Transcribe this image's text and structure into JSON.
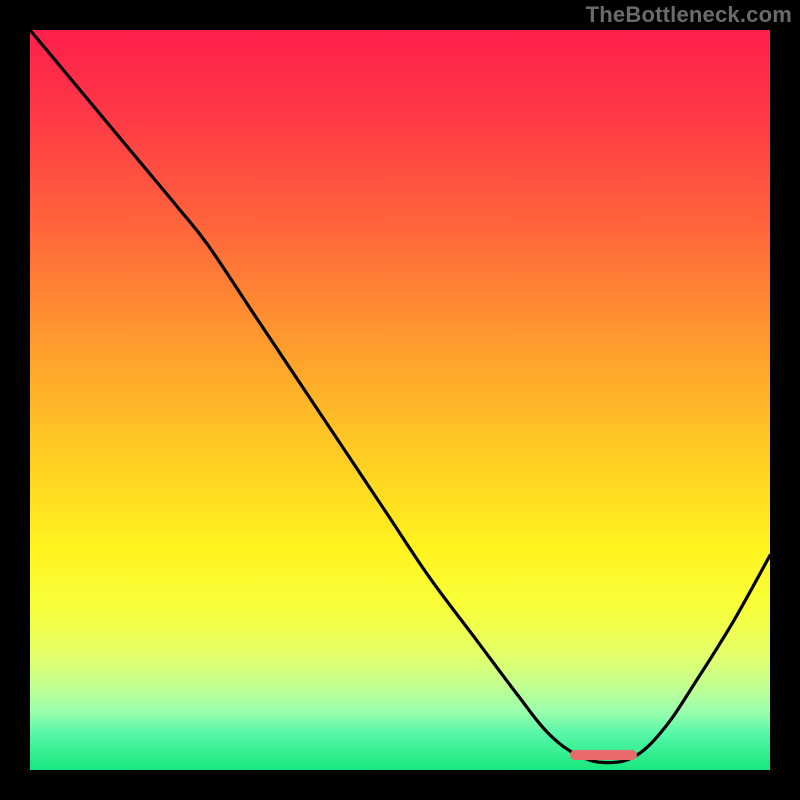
{
  "watermark": "TheBottleneck.com",
  "colors": {
    "frame": "#000000",
    "gradient_top": "#ff1f4c",
    "gradient_bottom": "#18e77e",
    "curve": "#000000",
    "marker": "#e96a6d"
  },
  "chart_data": {
    "type": "line",
    "title": "",
    "xlabel": "",
    "ylabel": "",
    "xlim": [
      0,
      100
    ],
    "ylim": [
      0,
      100
    ],
    "grid": false,
    "legend": false,
    "annotations": [
      {
        "name": "marker-bar",
        "x_start": 73,
        "x_end": 82,
        "y": 2
      }
    ],
    "series": [
      {
        "name": "bottleneck-curve",
        "x": [
          0,
          5,
          10,
          15,
          20,
          24,
          30,
          36,
          42,
          48,
          54,
          60,
          66,
          70,
          74,
          78,
          82,
          86,
          90,
          95,
          100
        ],
        "values": [
          100,
          94,
          88,
          82,
          76,
          71,
          62,
          53,
          44,
          35,
          26,
          18,
          10,
          5,
          2,
          1,
          2,
          6,
          12,
          20,
          29
        ]
      }
    ]
  }
}
